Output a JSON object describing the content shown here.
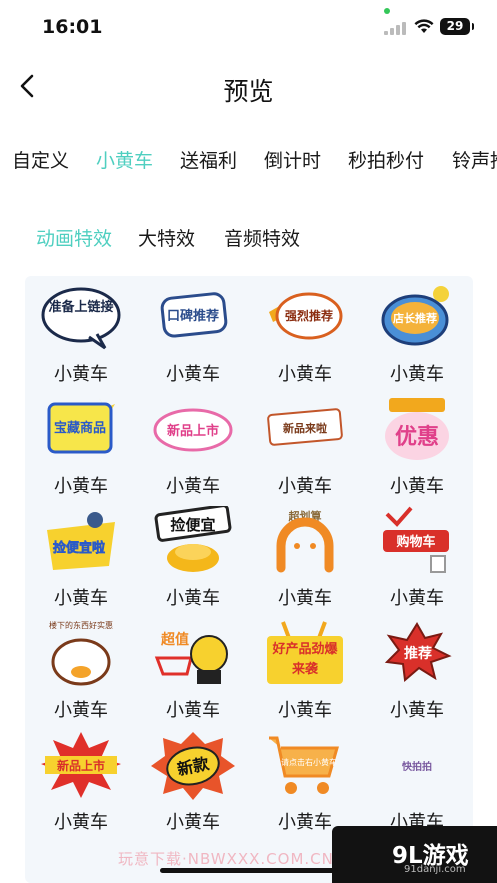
{
  "status": {
    "time": "16:01",
    "battery": "29"
  },
  "nav": {
    "title": "预览"
  },
  "categories": [
    {
      "label": "自定义",
      "active": false
    },
    {
      "label": "小黄车",
      "active": true
    },
    {
      "label": "送福利",
      "active": false
    },
    {
      "label": "倒计时",
      "active": false
    },
    {
      "label": "秒拍秒付",
      "active": false
    },
    {
      "label": "铃声推",
      "active": false
    }
  ],
  "sub_tabs": [
    {
      "label": "动画特效",
      "active": true
    },
    {
      "label": "大特效",
      "active": false
    },
    {
      "label": "音频特效",
      "active": false
    }
  ],
  "stickers": [
    {
      "text": "准备上链接",
      "label": "小黄车"
    },
    {
      "text": "口碑推荐",
      "label": "小黄车"
    },
    {
      "text": "强烈推荐",
      "label": "小黄车"
    },
    {
      "text": "店长推荐",
      "label": "小黄车"
    },
    {
      "text": "宝藏商品",
      "label": "小黄车"
    },
    {
      "text": "新品上市",
      "label": "小黄车"
    },
    {
      "text": "新品来啦",
      "label": "小黄车"
    },
    {
      "text": "优惠",
      "label": "小黄车"
    },
    {
      "text": "捡便宜啦",
      "label": "小黄车"
    },
    {
      "text": "捡便宜",
      "label": "小黄车"
    },
    {
      "text": "超划算",
      "label": "小黄车"
    },
    {
      "text": "购物车",
      "label": "小黄车"
    },
    {
      "text": "楼下的东西好实惠",
      "label": "小黄车"
    },
    {
      "text": "超值",
      "label": "小黄车"
    },
    {
      "text": "好产品劲爆来袭",
      "label": "小黄车"
    },
    {
      "text": "推荐",
      "label": "小黄车"
    },
    {
      "text": "新品上市",
      "label": "小黄车"
    },
    {
      "text": "新款",
      "label": "小黄车"
    },
    {
      "text": "请点击右小黄车",
      "label": "小黄车"
    },
    {
      "text": "快拍拍",
      "label": "小黄车"
    }
  ],
  "watermark": "玩意下载·NBWXXX.COM.CN",
  "corner": {
    "brand": "9L游戏",
    "site": "91danji.com"
  },
  "colors": {
    "accent": "#4fcfc0",
    "panel": "#f3f7fb"
  }
}
